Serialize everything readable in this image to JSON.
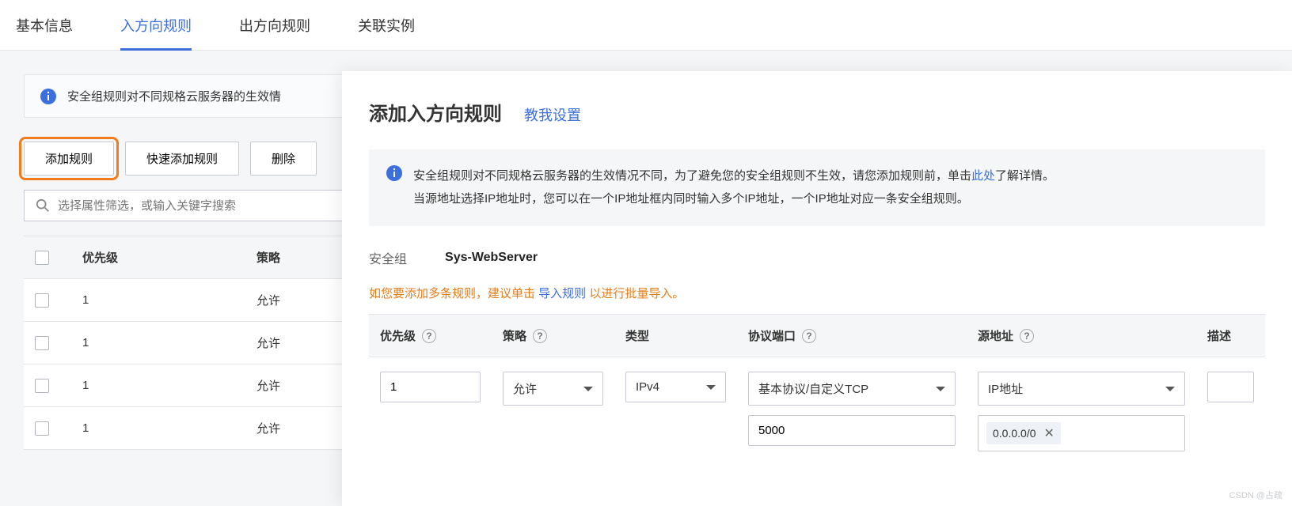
{
  "tabs": {
    "t1": "基本信息",
    "t2": "入方向规则",
    "t3": "出方向规则",
    "t4": "关联实例"
  },
  "main_banner": "安全组规则对不同规格云服务器的生效情",
  "buttons": {
    "add_rule": "添加规则",
    "quick_add": "快速添加规则",
    "delete": "删除"
  },
  "search_placeholder": "选择属性筛选，或输入关键字搜索",
  "table_headers": {
    "priority": "优先级",
    "policy": "策略"
  },
  "rows": [
    {
      "priority": "1",
      "policy": "允许"
    },
    {
      "priority": "1",
      "policy": "允许"
    },
    {
      "priority": "1",
      "policy": "允许"
    },
    {
      "priority": "1",
      "policy": "允许"
    }
  ],
  "modal": {
    "title": "添加入方向规则",
    "help_link": "教我设置",
    "banner_line1a": "安全组规则对不同规格云服务器的生效情况不同，为了避免您的安全组规则不生效，请您添加规则前，单击",
    "banner_link": "此处",
    "banner_line1b": "了解详情。",
    "banner_line2": "当源地址选择IP地址时，您可以在一个IP地址框内同时输入多个IP地址，一个IP地址对应一条安全组规则。",
    "sg_label": "安全组",
    "sg_value": "Sys-WebServer",
    "hint_a": "如您要添加多条规则，建议单击 ",
    "hint_link": "导入规则",
    "hint_b": " 以进行批量导入。",
    "cols": {
      "priority": "优先级",
      "policy": "策略",
      "type": "类型",
      "protocol": "协议端口",
      "source": "源地址",
      "desc": "描述"
    },
    "vals": {
      "priority": "1",
      "policy": "允许",
      "type": "IPv4",
      "protocol_select": "基本协议/自定义TCP",
      "protocol_port": "5000",
      "source_select": "IP地址",
      "source_chip": "0.0.0.0/0"
    }
  },
  "watermark": "CSDN @占疏"
}
